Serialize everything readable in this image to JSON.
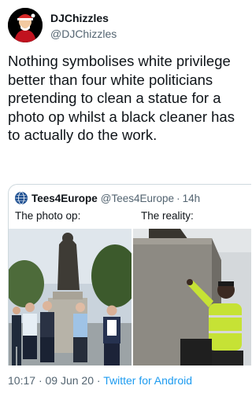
{
  "author": {
    "display_name": "DJChizzles",
    "handle": "@DJChizzles"
  },
  "tweet": {
    "text": "Nothing symbolises white privilege better than four white politicians pretending to clean a statue for a photo op whilst a black cleaner has to actually do the work."
  },
  "quoted_tweet": {
    "author_name": "Tees4Europe",
    "handle": "@Tees4Europe",
    "separator": "·",
    "age": "14h",
    "left_label": "The photo op:",
    "right_label": "The reality:"
  },
  "footer": {
    "time": "10:17",
    "dot": "·",
    "date": "09 Jun 20",
    "source": "Twitter for Android"
  },
  "colors": {
    "link_blue": "#1d9bf0",
    "secondary_text": "#536471",
    "border": "#cfd9de"
  }
}
